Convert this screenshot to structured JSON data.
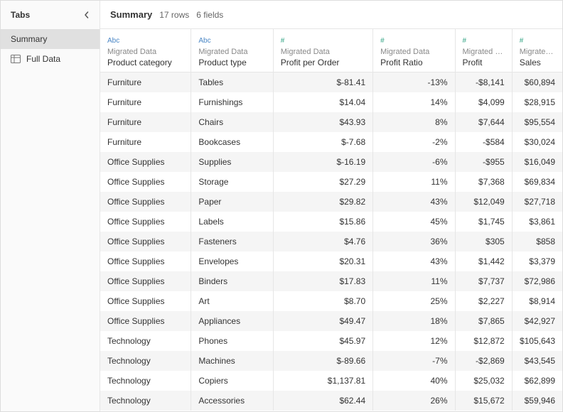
{
  "sidebar": {
    "title": "Tabs",
    "items": [
      {
        "label": "Summary"
      },
      {
        "label": "Full Data"
      }
    ]
  },
  "header": {
    "title": "Summary",
    "rows_label": "17 rows",
    "fields_label": "6 fields"
  },
  "columns": [
    {
      "type_glyph": "Abc",
      "type_class": "str",
      "source": "Migrated Data",
      "name": "Product category",
      "align": "left"
    },
    {
      "type_glyph": "Abc",
      "type_class": "str",
      "source": "Migrated Data",
      "name": "Product type",
      "align": "left"
    },
    {
      "type_glyph": "#",
      "type_class": "num",
      "source": "Migrated Data",
      "name": "Profit per Order",
      "align": "right"
    },
    {
      "type_glyph": "#",
      "type_class": "num",
      "source": "Migrated Data",
      "name": "Profit Ratio",
      "align": "right"
    },
    {
      "type_glyph": "#",
      "type_class": "num",
      "source": "Migrated D...",
      "name": "Profit",
      "align": "right"
    },
    {
      "type_glyph": "#",
      "type_class": "num",
      "source": "Migrated D...",
      "name": "Sales",
      "align": "right"
    }
  ],
  "rows": [
    [
      "Furniture",
      "Tables",
      "$-81.41",
      "-13%",
      "-$8,141",
      "$60,894"
    ],
    [
      "Furniture",
      "Furnishings",
      "$14.04",
      "14%",
      "$4,099",
      "$28,915"
    ],
    [
      "Furniture",
      "Chairs",
      "$43.93",
      "8%",
      "$7,644",
      "$95,554"
    ],
    [
      "Furniture",
      "Bookcases",
      "$-7.68",
      "-2%",
      "-$584",
      "$30,024"
    ],
    [
      "Office Supplies",
      "Supplies",
      "$-16.19",
      "-6%",
      "-$955",
      "$16,049"
    ],
    [
      "Office Supplies",
      "Storage",
      "$27.29",
      "11%",
      "$7,368",
      "$69,834"
    ],
    [
      "Office Supplies",
      "Paper",
      "$29.82",
      "43%",
      "$12,049",
      "$27,718"
    ],
    [
      "Office Supplies",
      "Labels",
      "$15.86",
      "45%",
      "$1,745",
      "$3,861"
    ],
    [
      "Office Supplies",
      "Fasteners",
      "$4.76",
      "36%",
      "$305",
      "$858"
    ],
    [
      "Office Supplies",
      "Envelopes",
      "$20.31",
      "43%",
      "$1,442",
      "$3,379"
    ],
    [
      "Office Supplies",
      "Binders",
      "$17.83",
      "11%",
      "$7,737",
      "$72,986"
    ],
    [
      "Office Supplies",
      "Art",
      "$8.70",
      "25%",
      "$2,227",
      "$8,914"
    ],
    [
      "Office Supplies",
      "Appliances",
      "$49.47",
      "18%",
      "$7,865",
      "$42,927"
    ],
    [
      "Technology",
      "Phones",
      "$45.97",
      "12%",
      "$12,872",
      "$105,643"
    ],
    [
      "Technology",
      "Machines",
      "$-89.66",
      "-7%",
      "-$2,869",
      "$43,545"
    ],
    [
      "Technology",
      "Copiers",
      "$1,137.81",
      "40%",
      "$25,032",
      "$62,899"
    ],
    [
      "Technology",
      "Accessories",
      "$62.44",
      "26%",
      "$15,672",
      "$59,946"
    ]
  ],
  "chart_data": {
    "type": "table",
    "columns": [
      "Product category",
      "Product type",
      "Profit per Order",
      "Profit Ratio",
      "Profit",
      "Sales"
    ],
    "rows": [
      [
        "Furniture",
        "Tables",
        -81.41,
        -0.13,
        -8141,
        60894
      ],
      [
        "Furniture",
        "Furnishings",
        14.04,
        0.14,
        4099,
        28915
      ],
      [
        "Furniture",
        "Chairs",
        43.93,
        0.08,
        7644,
        95554
      ],
      [
        "Furniture",
        "Bookcases",
        -7.68,
        -0.02,
        -584,
        30024
      ],
      [
        "Office Supplies",
        "Supplies",
        -16.19,
        -0.06,
        -955,
        16049
      ],
      [
        "Office Supplies",
        "Storage",
        27.29,
        0.11,
        7368,
        69834
      ],
      [
        "Office Supplies",
        "Paper",
        29.82,
        0.43,
        12049,
        27718
      ],
      [
        "Office Supplies",
        "Labels",
        15.86,
        0.45,
        1745,
        3861
      ],
      [
        "Office Supplies",
        "Fasteners",
        4.76,
        0.36,
        305,
        858
      ],
      [
        "Office Supplies",
        "Envelopes",
        20.31,
        0.43,
        1442,
        3379
      ],
      [
        "Office Supplies",
        "Binders",
        17.83,
        0.11,
        7737,
        72986
      ],
      [
        "Office Supplies",
        "Art",
        8.7,
        0.25,
        2227,
        8914
      ],
      [
        "Office Supplies",
        "Appliances",
        49.47,
        0.18,
        7865,
        42927
      ],
      [
        "Technology",
        "Phones",
        45.97,
        0.12,
        12872,
        105643
      ],
      [
        "Technology",
        "Machines",
        -89.66,
        -0.07,
        -2869,
        43545
      ],
      [
        "Technology",
        "Copiers",
        1137.81,
        0.4,
        25032,
        62899
      ],
      [
        "Technology",
        "Accessories",
        62.44,
        0.26,
        15672,
        59946
      ]
    ]
  }
}
